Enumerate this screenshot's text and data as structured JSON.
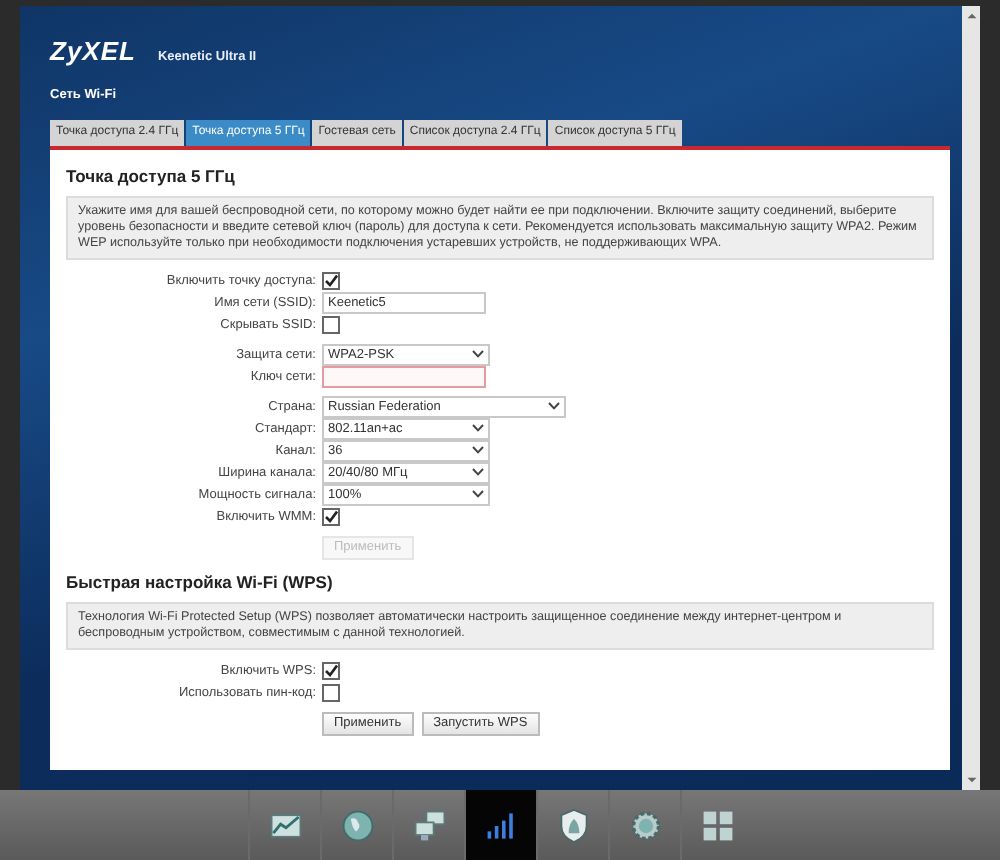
{
  "header": {
    "logo": "ZyXEL",
    "model": "Keenetic Ultra II",
    "page_title": "Сеть Wi-Fi"
  },
  "tabs": [
    {
      "label": "Точка доступа 2.4 ГГц",
      "selected": false
    },
    {
      "label": "Точка доступа 5 ГГц",
      "selected": true
    },
    {
      "label": "Гостевая сеть",
      "selected": false
    },
    {
      "label": "Список доступа 2.4 ГГц",
      "selected": false
    },
    {
      "label": "Список доступа 5 ГГц",
      "selected": false
    }
  ],
  "sections": [
    {
      "title": "Точка доступа 5 ГГц",
      "description": "Укажите имя для вашей беспроводной сети, по которому можно будет найти ее при подключении. Включите защиту соединений, выберите уровень безопасности и введите сетевой ключ (пароль) для доступа к сети. Рекомендуется использовать максимальную защиту WPA2. Режим WEP используйте только при необходимости подключения устаревших устройств, не поддерживающих WPA.",
      "field_groups": [
        [
          {
            "kind": "checkbox",
            "label": "Включить точку доступа:",
            "checked": true
          },
          {
            "kind": "text",
            "label": "Имя сети (SSID):",
            "value": "Keenetic5",
            "invalid": false
          },
          {
            "kind": "checkbox",
            "label": "Скрывать SSID:",
            "checked": false
          }
        ],
        [
          {
            "kind": "select",
            "label": "Защита сети:",
            "value": "WPA2-PSK",
            "wide": false
          },
          {
            "kind": "text",
            "label": "Ключ сети:",
            "invalid": true
          }
        ],
        [
          {
            "kind": "select",
            "label": "Страна:",
            "value": "Russian Federation",
            "wide": true
          },
          {
            "kind": "select",
            "label": "Стандарт:",
            "value": "802.11an+ac",
            "wide": false
          },
          {
            "kind": "select",
            "label": "Канал:",
            "value": "36",
            "wide": false
          },
          {
            "kind": "select",
            "label": "Ширина канала:",
            "value": "20/40/80 МГц",
            "wide": false
          },
          {
            "kind": "select",
            "label": "Мощность сигнала:",
            "value": "100%",
            "wide": false
          },
          {
            "kind": "checkbox",
            "label": "Включить WMM:",
            "checked": true
          }
        ]
      ],
      "buttons": [
        {
          "label": "Применить",
          "disabled": true
        }
      ]
    },
    {
      "title": "Быстрая настройка Wi-Fi (WPS)",
      "description": "Технология Wi-Fi Protected Setup (WPS) позволяет автоматически настроить защищенное соединение между интернет-центром и беспроводным устройством, совместимым с данной технологией.",
      "field_groups": [
        [
          {
            "kind": "checkbox",
            "label": "Включить WPS:",
            "checked": true
          },
          {
            "kind": "checkbox",
            "label": "Использовать пин-код:",
            "checked": false
          }
        ]
      ],
      "buttons": [
        {
          "label": "Применить",
          "disabled": false
        },
        {
          "label": "Запустить WPS",
          "disabled": false
        }
      ]
    }
  ],
  "dock": [
    {
      "kind": "chart",
      "selected": false
    },
    {
      "kind": "globe",
      "selected": false
    },
    {
      "kind": "computers",
      "selected": false
    },
    {
      "kind": "signal",
      "selected": true
    },
    {
      "kind": "shield",
      "selected": false
    },
    {
      "kind": "gear",
      "selected": false
    },
    {
      "kind": "grid",
      "selected": false
    }
  ]
}
